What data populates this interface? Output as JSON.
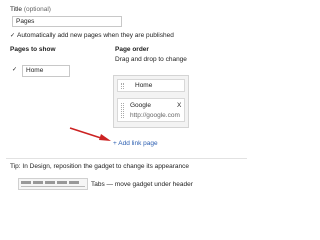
{
  "title_field": {
    "label": "Title",
    "note": "(optional)",
    "value": "Pages"
  },
  "auto_add": {
    "checked": "✓",
    "label": "Automatically add new pages when they are published"
  },
  "pages_to_show": {
    "heading": "Pages to show",
    "checked": "✓",
    "item": "Home"
  },
  "page_order": {
    "heading": "Page order",
    "instructions": "Drag and drop to change",
    "items": [
      {
        "title": "Home"
      },
      {
        "title": "Google",
        "remove": "X",
        "url": "http://google.com"
      }
    ],
    "add_link": "+ Add link page"
  },
  "tip": "Tip: In Design, reposition the gadget to change its appearance",
  "preview_caption": "Tabs — move gadget under header",
  "colors": {
    "link": "#2a5db0",
    "arrow": "#cc2222"
  },
  "icons": {
    "check": "check-icon",
    "remove": "close-icon",
    "grip": "drag-handle-icon",
    "arrow": "red-arrow-icon"
  }
}
